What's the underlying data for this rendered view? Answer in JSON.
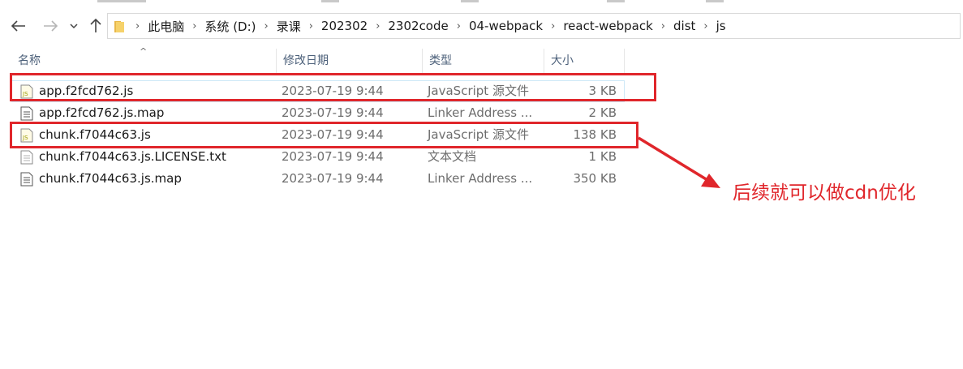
{
  "window": {
    "toolbar_strip": "ribbon-edge"
  },
  "nav": {
    "back_icon": "arrow-left-icon",
    "forward_icon": "arrow-right-icon",
    "recent_icon": "chevron-down-icon",
    "up_icon": "arrow-up-icon"
  },
  "address": {
    "crumbs": [
      "此电脑",
      "系统 (D:)",
      "录课",
      "202302",
      "2302code",
      "04-webpack",
      "react-webpack",
      "dist",
      "js"
    ],
    "separator": "›"
  },
  "columns": {
    "name": "名称",
    "date": "修改日期",
    "type": "类型",
    "size": "大小"
  },
  "files": [
    {
      "name": "app.f2fcd762.js",
      "date": "2023-07-19 9:44",
      "type": "JavaScript 源文件",
      "size": "3 KB",
      "icon": "js-file-icon"
    },
    {
      "name": "app.f2fcd762.js.map",
      "date": "2023-07-19 9:44",
      "type": "Linker Address ...",
      "size": "2 KB",
      "icon": "document-icon"
    },
    {
      "name": "chunk.f7044c63.js",
      "date": "2023-07-19 9:44",
      "type": "JavaScript 源文件",
      "size": "138 KB",
      "icon": "js-file-icon"
    },
    {
      "name": "chunk.f7044c63.js.LICENSE.txt",
      "date": "2023-07-19 9:44",
      "type": "文本文档",
      "size": "1 KB",
      "icon": "text-file-icon"
    },
    {
      "name": "chunk.f7044c63.js.map",
      "date": "2023-07-19 9:44",
      "type": "Linker Address ...",
      "size": "350 KB",
      "icon": "document-icon"
    }
  ],
  "annotation": {
    "text": "后续就可以做cdn优化",
    "color": "#e0262b"
  }
}
